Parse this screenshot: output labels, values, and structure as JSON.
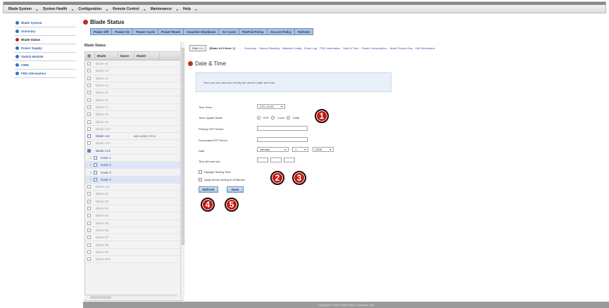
{
  "topmenu": [
    {
      "label": "Blade System"
    },
    {
      "label": "System Health"
    },
    {
      "label": "Configuration"
    },
    {
      "label": "Remote Control"
    },
    {
      "label": "Maintenance"
    },
    {
      "label": "Help"
    },
    {
      "label": ""
    }
  ],
  "sidebar": {
    "items": [
      {
        "label": "Blade System"
      },
      {
        "label": "Summary"
      },
      {
        "label": "Blade Status"
      },
      {
        "label": "Power Supply"
      },
      {
        "label": "Switch Module"
      },
      {
        "label": "CMM"
      },
      {
        "label": "FRU Information"
      }
    ]
  },
  "blade_status": {
    "title": "Blade Status",
    "actions": [
      "Power Off",
      "Power On",
      "Power Cycle",
      "Power Reset",
      "Graceful Shutdown",
      "AC Cycle",
      "PwrFail Policy",
      "ACLost Policy",
      "Refresh"
    ],
    "grid_title": "Blade Status",
    "columns": [
      "Blade",
      "Name",
      "Model"
    ],
    "rows": [
      {
        "blade": "Blade A1",
        "model": ""
      },
      {
        "blade": "Blade A2",
        "model": ""
      },
      {
        "blade": "Blade A3",
        "model": ""
      },
      {
        "blade": "Blade A4",
        "model": ""
      },
      {
        "blade": "Blade A5",
        "model": ""
      },
      {
        "blade": "Blade A6",
        "model": ""
      },
      {
        "blade": "Blade A7",
        "model": ""
      },
      {
        "blade": "Blade A8",
        "model": ""
      },
      {
        "blade": "Blade A9",
        "model": ""
      },
      {
        "blade": "Blade A10",
        "model": ""
      },
      {
        "blade": "Blade A11",
        "model": "MBI-6128R-T2/T2X"
      },
      {
        "blade": "Blade A12",
        "model": ""
      },
      {
        "blade": "Blade A13",
        "model": ""
      },
      {
        "blade": "Node 1",
        "model": ""
      },
      {
        "blade": "Node 2",
        "model": ""
      },
      {
        "blade": "Node 3",
        "model": ""
      },
      {
        "blade": "Node 4",
        "model": ""
      },
      {
        "blade": "Blade A14",
        "model": ""
      },
      {
        "blade": "Blade B1",
        "model": ""
      },
      {
        "blade": "Blade B2",
        "model": ""
      },
      {
        "blade": "Blade B3",
        "model": ""
      },
      {
        "blade": "Blade B4",
        "model": ""
      },
      {
        "blade": "Blade B5",
        "model": ""
      },
      {
        "blade": "Blade B6",
        "model": ""
      },
      {
        "blade": "Blade B7",
        "model": ""
      },
      {
        "blade": "Blade B8",
        "model": ""
      },
      {
        "blade": "Blade B9",
        "model": ""
      },
      {
        "blade": "Blade B10",
        "model": ""
      }
    ]
  },
  "detail": {
    "hide_label": "Hide >>>",
    "node_label": "[Blade A13 Node 1]",
    "sep": "----",
    "tabs": [
      "Summary",
      "Sensor Reading",
      "Network Config",
      "Event Log",
      "FRU Information",
      "Date & Time",
      "Power Consumption",
      "Node Product Key",
      "HW Information"
    ],
    "title": "Date & Time",
    "info": "Here you can view and modify the device's date and time.",
    "fields": {
      "time_zone_label": "Time Zone",
      "time_zone_value": "UTC-12:00",
      "update_mode_label": "Time Update Mode",
      "modes": [
        "NTP",
        "Local",
        "CMM"
      ],
      "primary_ntp_label": "Primary NTP Server",
      "secondary_ntp_label": "Secondary NTP Server",
      "date_label": "Date",
      "month": "January",
      "day": "1",
      "year": "2005",
      "time_label": "Time (hh:mm:ss)",
      "dst_label": "Daylight Saving Time",
      "apply_all_label": "Apply above setting to all Blades"
    },
    "refresh_label": "Refresh",
    "save_label": "Save"
  },
  "callouts": [
    "1",
    "2",
    "3",
    "4",
    "5"
  ],
  "footer": "Copyright © 2013 Super Micro Computer, Inc.",
  "colors": {
    "accent_red": "#c21b14",
    "link_blue": "#2851a0",
    "toolbar_blue": "#a9c2e0"
  }
}
